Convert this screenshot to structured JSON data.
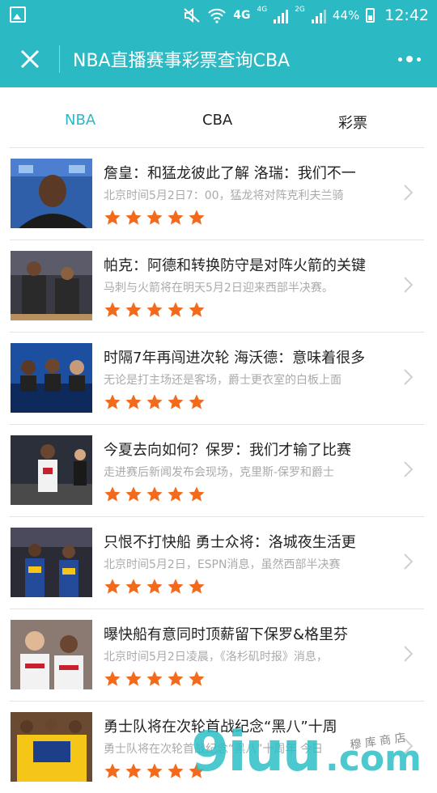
{
  "status_bar": {
    "network_1": "4G",
    "network_2": "4G",
    "network_3": "2G",
    "battery": "44%",
    "time": "12:42"
  },
  "header": {
    "title": "NBA直播赛事彩票查询CBA"
  },
  "tabs": [
    {
      "label": "NBA",
      "active": true
    },
    {
      "label": "CBA",
      "active": false
    },
    {
      "label": "彩票",
      "active": false
    }
  ],
  "colors": {
    "accent": "#2bb9c4",
    "star": "#f26b1d"
  },
  "articles": [
    {
      "headline": "詹皇：和猛龙彼此了解 洛瑞：我们不一",
      "summary": "北京时间5月2日7：00，猛龙将对阵克利夫兰骑",
      "rating": 5
    },
    {
      "headline": "帕克：阿德和转换防守是对阵火箭的关键",
      "summary": "马刺与火箭将在明天5月2日迎来西部半决赛。",
      "rating": 5
    },
    {
      "headline": "时隔7年再闯进次轮 海沃德：意味着很多",
      "summary": "无论是打主场还是客场，爵士更衣室的白板上面",
      "rating": 5
    },
    {
      "headline": "今夏去向如何？保罗：我们才输了比赛",
      "summary": "走进赛后新闻发布会现场，克里斯-保罗和爵士",
      "rating": 5
    },
    {
      "headline": "只恨不打快船 勇士众将：洛城夜生活更",
      "summary": "北京时间5月2日，ESPN消息，虽然西部半决赛",
      "rating": 5
    },
    {
      "headline": "曝快船有意同时顶薪留下保罗&格里芬",
      "summary": "北京时间5月2日凌晨，《洛杉矶时报》消息，",
      "rating": 5
    },
    {
      "headline": "勇士队将在次轮首战纪念“黑八”十周",
      "summary": "勇士队将在次轮首战纪念“黑八”十周年 今日",
      "rating": 5
    }
  ],
  "watermark": {
    "brand": "9iuu",
    "domain": ".com",
    "handwriting": "穆 库 商 店"
  }
}
